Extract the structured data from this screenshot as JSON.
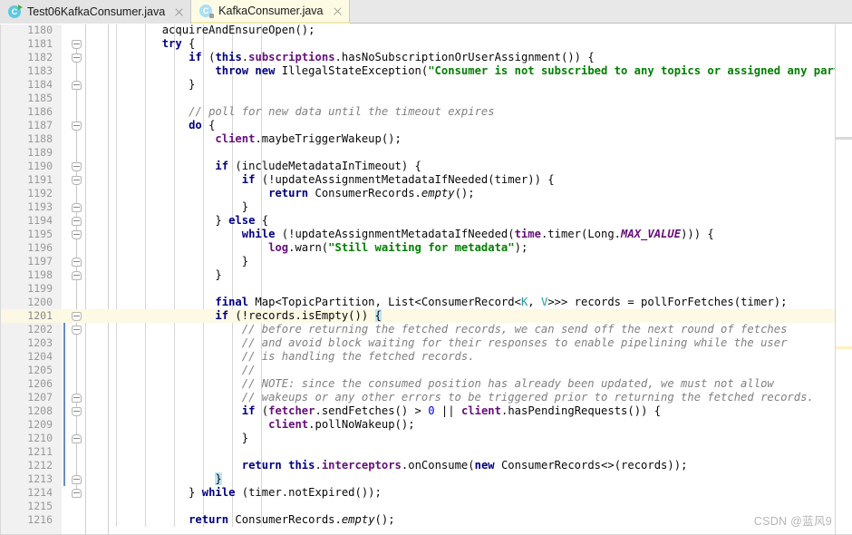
{
  "window": {
    "title": "KafkaConsumer.java",
    "watermark": "CSDN @蓝风9"
  },
  "tabs": [
    {
      "label": "Test06KafkaConsumer.java",
      "icon": "java-class-run-icon",
      "active": false,
      "close_icon": "close-icon"
    },
    {
      "label": "KafkaConsumer.java",
      "icon": "java-class-library-icon",
      "active": true,
      "close_icon": "close-icon"
    }
  ],
  "editor": {
    "language": "java",
    "first_line_number": 1180,
    "current_line_number": 1201,
    "line_height_px": 15,
    "partial_top_line_text": "                                                                        ",
    "colors": {
      "keyword": "#000080",
      "string": "#008000",
      "comment": "#808080",
      "field": "#660e7a",
      "number": "#0000ff",
      "type_param": "#20999d",
      "current_line_bg": "#fdf9e4",
      "bracket_match_bg": "#c0e4f8",
      "gutter_bg": "#f1f1f1",
      "caret_bar": "#6a8bbd"
    },
    "lines": [
      {
        "n": 1180,
        "fold": null,
        "html": "        acquireAndEnsureOpen();"
      },
      {
        "n": 1181,
        "fold": "start",
        "html": "        <span class=\"kw\">try</span> {"
      },
      {
        "n": 1182,
        "fold": "start",
        "html": "            <span class=\"kw\">if</span> (<span class=\"kw\">this</span>.<span class=\"fld\">subscriptions</span>.hasNoSubscriptionOrUserAssignment()) {"
      },
      {
        "n": 1183,
        "fold": null,
        "html": "                <span class=\"kw\">throw new</span> IllegalStateException(<span class=\"str\">\"Consumer is not subscribed to any topics or assigned any partitions\"</span>);"
      },
      {
        "n": 1184,
        "fold": "end",
        "html": "            }"
      },
      {
        "n": 1185,
        "fold": null,
        "html": ""
      },
      {
        "n": 1186,
        "fold": null,
        "html": "            <span class=\"cmt\">// poll for new data until the timeout expires</span>"
      },
      {
        "n": 1187,
        "fold": "start",
        "html": "            <span class=\"kw\">do</span> {"
      },
      {
        "n": 1188,
        "fold": null,
        "html": "                <span class=\"fld\">client</span>.maybeTriggerWakeup();"
      },
      {
        "n": 1189,
        "fold": null,
        "html": ""
      },
      {
        "n": 1190,
        "fold": "start",
        "html": "                <span class=\"kw\">if</span> (includeMetadataInTimeout) {"
      },
      {
        "n": 1191,
        "fold": "start",
        "html": "                    <span class=\"kw\">if</span> (!updateAssignmentMetadataIfNeeded(timer)) {"
      },
      {
        "n": 1192,
        "fold": null,
        "html": "                        <span class=\"kw\">return</span> ConsumerRecords.<span class=\"stat\">empty</span>();"
      },
      {
        "n": 1193,
        "fold": "end",
        "html": "                    }"
      },
      {
        "n": 1194,
        "fold": "end",
        "html": "                } <span class=\"kw\">else</span> {"
      },
      {
        "n": 1195,
        "fold": "start",
        "html": "                    <span class=\"kw\">while</span> (!updateAssignmentMetadataIfNeeded(<span class=\"fld\">time</span>.timer(Long.<span class=\"cnst\">MAX_VALUE</span>))) {"
      },
      {
        "n": 1196,
        "fold": null,
        "html": "                        <span class=\"fld\">log</span>.warn(<span class=\"str\">\"Still waiting for metadata\"</span>);"
      },
      {
        "n": 1197,
        "fold": "end",
        "html": "                    }"
      },
      {
        "n": 1198,
        "fold": "end",
        "html": "                }"
      },
      {
        "n": 1199,
        "fold": null,
        "html": ""
      },
      {
        "n": 1200,
        "fold": null,
        "html": "                <span class=\"kw\">final</span> Map&lt;TopicPartition, List&lt;ConsumerRecord&lt;<span class=\"tpar\">K</span>, <span class=\"tpar\">V</span>&gt;&gt;&gt; records = pollForFetches(timer);"
      },
      {
        "n": 1201,
        "fold": "start",
        "html": "                <span class=\"kw\">if</span> (!records.isEmpty()) <span class=\"brk\">{</span>"
      },
      {
        "n": 1202,
        "fold": "start",
        "html": "                    <span class=\"cmt\">// before returning the fetched records, we can send off the next round of fetches</span>"
      },
      {
        "n": 1203,
        "fold": null,
        "html": "                    <span class=\"cmt\">// and avoid block waiting for their responses to enable pipelining while the user</span>"
      },
      {
        "n": 1204,
        "fold": null,
        "html": "                    <span class=\"cmt\">// is handling the fetched records.</span>"
      },
      {
        "n": 1205,
        "fold": null,
        "html": "                    <span class=\"cmt\">//</span>"
      },
      {
        "n": 1206,
        "fold": null,
        "html": "                    <span class=\"cmt\">// NOTE: since the consumed position has already been updated, we must not allow</span>"
      },
      {
        "n": 1207,
        "fold": "end",
        "html": "                    <span class=\"cmt\">// wakeups or any other errors to be triggered prior to returning the fetched records.</span>"
      },
      {
        "n": 1208,
        "fold": "start",
        "html": "                    <span class=\"kw\">if</span> (<span class=\"fld\">fetcher</span>.sendFetches() &gt; <span class=\"num\">0</span> || <span class=\"fld\">client</span>.hasPendingRequests()) {"
      },
      {
        "n": 1209,
        "fold": null,
        "html": "                        <span class=\"fld\">client</span>.pollNoWakeup();"
      },
      {
        "n": 1210,
        "fold": "end",
        "html": "                    }"
      },
      {
        "n": 1211,
        "fold": null,
        "html": ""
      },
      {
        "n": 1212,
        "fold": null,
        "html": "                    <span class=\"kw\">return</span> <span class=\"kw\">this</span>.<span class=\"fld\">interceptors</span>.onConsume(<span class=\"kw\">new</span> ConsumerRecords&lt;&gt;(records));"
      },
      {
        "n": 1213,
        "fold": "end",
        "html": "                <span class=\"brk\">}</span>"
      },
      {
        "n": 1214,
        "fold": "end",
        "html": "            } <span class=\"kw\">while</span> (timer.notExpired());"
      },
      {
        "n": 1215,
        "fold": null,
        "html": ""
      },
      {
        "n": 1216,
        "fold": null,
        "html": "            <span class=\"kw\">return</span> ConsumerRecords.<span class=\"stat\">empty</span>();"
      }
    ],
    "indent_guides_x": [
      128,
      160,
      192,
      224,
      256,
      288
    ],
    "caret_bar": {
      "from_line": 1201,
      "to_line": 1213
    },
    "fold_spine": {
      "from_line": 1181,
      "to_line": 1214
    }
  }
}
